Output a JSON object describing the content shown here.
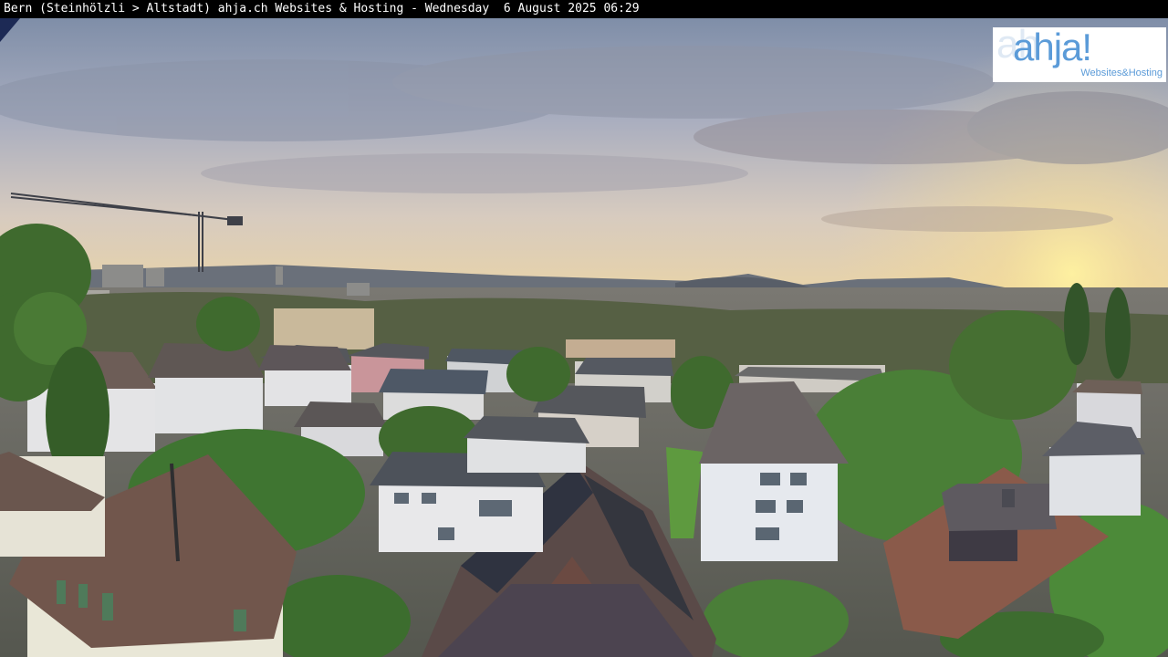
{
  "caption": "Bern (Steinhölzli > Altstadt) ahja.ch Websites & Hosting - Wednesday  6 August 2025 06:29",
  "logo": {
    "main": "ahja!",
    "sub": "Websites&Hosting"
  },
  "colors": {
    "sky_top": "#7f8ea8",
    "sky_mid": "#b6b5c3",
    "sky_horizon": "#f3d89a",
    "sun": "#ffe36a",
    "hills": "#5e6570",
    "foliage": "#3f6a2e",
    "roof_brown": "#6b4e42",
    "roof_grey": "#4e535c",
    "wall": "#dfe2e4",
    "logo_blue": "#5b9bd8"
  }
}
